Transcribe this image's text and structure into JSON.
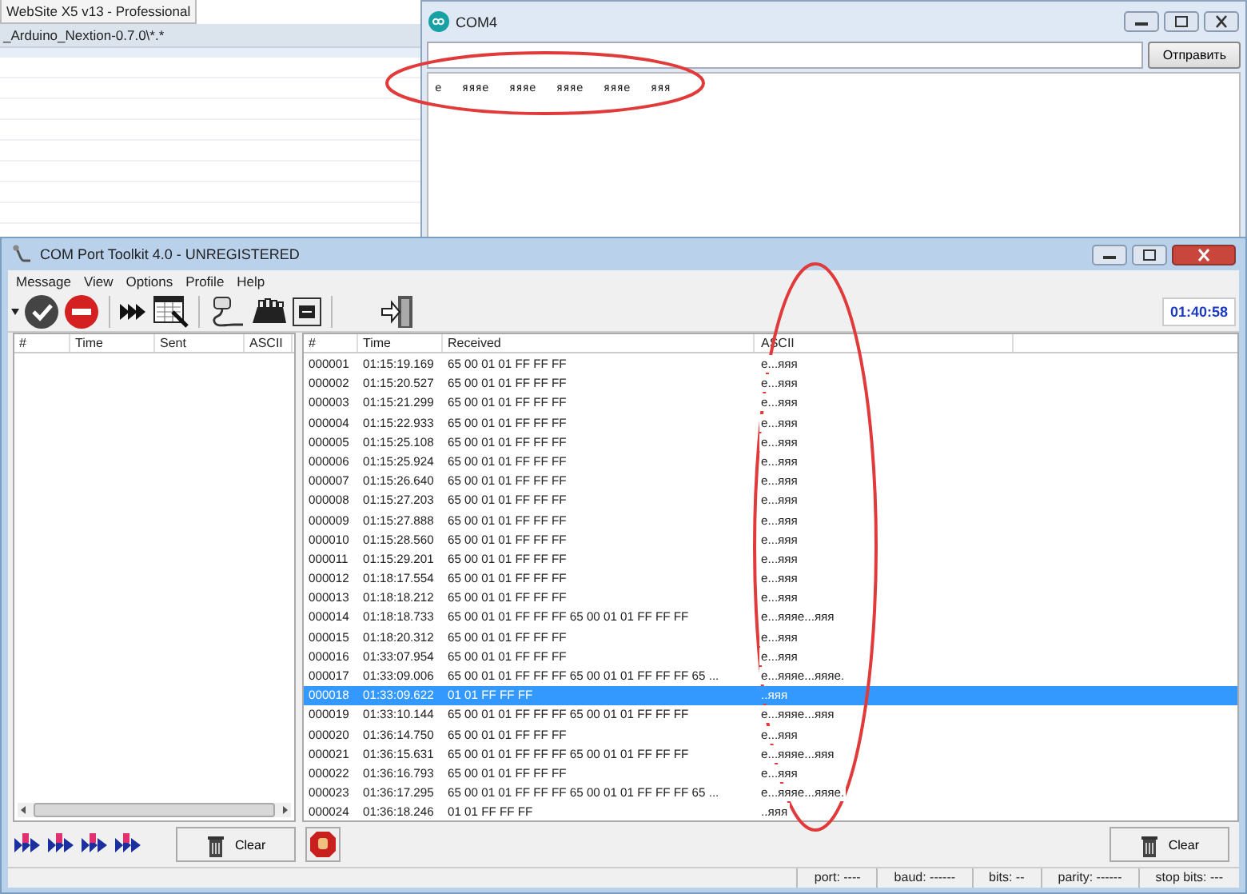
{
  "background_window": {
    "title": "WebSite X5 v13 - Professional",
    "path": "_Arduino_Nextion-0.7.0\\*.*"
  },
  "com4": {
    "title": "COM4",
    "send_button": "Отправить",
    "output": "e   яяяe   яяяe   яяяe   яяяe   яяя"
  },
  "toolkit": {
    "title": "COM Port Toolkit 4.0 - UNREGISTERED",
    "menu": [
      "Message",
      "View",
      "Options",
      "Profile",
      "Help"
    ],
    "clock": "01:40:58",
    "sent_table": {
      "columns": [
        "#",
        "Time",
        "Sent",
        "ASCII"
      ]
    },
    "received_table": {
      "columns": [
        "#",
        "Time",
        "Received",
        "ASCII"
      ],
      "rows": [
        {
          "num": "000001",
          "time": "01:15:19.169",
          "received": "65 00 01 01 FF FF FF",
          "ascii": "e...яяя",
          "selected": false
        },
        {
          "num": "000002",
          "time": "01:15:20.527",
          "received": "65 00 01 01 FF FF FF",
          "ascii": "e...яяя",
          "selected": false
        },
        {
          "num": "000003",
          "time": "01:15:21.299",
          "received": "65 00 01 01 FF FF FF",
          "ascii": "e...яяя",
          "selected": false
        },
        {
          "num": "000004",
          "time": "01:15:22.933",
          "received": "65 00 01 01 FF FF FF",
          "ascii": "e...яяя",
          "selected": false
        },
        {
          "num": "000005",
          "time": "01:15:25.108",
          "received": "65 00 01 01 FF FF FF",
          "ascii": "e...яяя",
          "selected": false
        },
        {
          "num": "000006",
          "time": "01:15:25.924",
          "received": "65 00 01 01 FF FF FF",
          "ascii": "e...яяя",
          "selected": false
        },
        {
          "num": "000007",
          "time": "01:15:26.640",
          "received": "65 00 01 01 FF FF FF",
          "ascii": "e...яяя",
          "selected": false
        },
        {
          "num": "000008",
          "time": "01:15:27.203",
          "received": "65 00 01 01 FF FF FF",
          "ascii": "e...яяя",
          "selected": false
        },
        {
          "num": "000009",
          "time": "01:15:27.888",
          "received": "65 00 01 01 FF FF FF",
          "ascii": "e...яяя",
          "selected": false
        },
        {
          "num": "000010",
          "time": "01:15:28.560",
          "received": "65 00 01 01 FF FF FF",
          "ascii": "e...яяя",
          "selected": false
        },
        {
          "num": "000011",
          "time": "01:15:29.201",
          "received": "65 00 01 01 FF FF FF",
          "ascii": "e...яяя",
          "selected": false
        },
        {
          "num": "000012",
          "time": "01:18:17.554",
          "received": "65 00 01 01 FF FF FF",
          "ascii": "e...яяя",
          "selected": false
        },
        {
          "num": "000013",
          "time": "01:18:18.212",
          "received": "65 00 01 01 FF FF FF",
          "ascii": "e...яяя",
          "selected": false
        },
        {
          "num": "000014",
          "time": "01:18:18.733",
          "received": "65 00 01 01 FF FF FF 65 00 01 01 FF FF FF",
          "ascii": "e...яяяe...яяя",
          "selected": false
        },
        {
          "num": "000015",
          "time": "01:18:20.312",
          "received": "65 00 01 01 FF FF FF",
          "ascii": "e...яяя",
          "selected": false
        },
        {
          "num": "000016",
          "time": "01:33:07.954",
          "received": "65 00 01 01 FF FF FF",
          "ascii": "e...яяя",
          "selected": false
        },
        {
          "num": "000017",
          "time": "01:33:09.006",
          "received": "65 00 01 01 FF FF FF 65 00 01 01 FF FF FF 65 ...",
          "ascii": "e...яяяe...яяяe.",
          "selected": false
        },
        {
          "num": "000018",
          "time": "01:33:09.622",
          "received": "01 01 FF FF FF",
          "ascii": "..яяя",
          "selected": true
        },
        {
          "num": "000019",
          "time": "01:33:10.144",
          "received": "65 00 01 01 FF FF FF 65 00 01 01 FF FF FF",
          "ascii": "e...яяяe...яяя",
          "selected": false
        },
        {
          "num": "000020",
          "time": "01:36:14.750",
          "received": "65 00 01 01 FF FF FF",
          "ascii": "e...яяя",
          "selected": false
        },
        {
          "num": "000021",
          "time": "01:36:15.631",
          "received": "65 00 01 01 FF FF FF 65 00 01 01 FF FF FF",
          "ascii": "e...яяяe...яяя",
          "selected": false
        },
        {
          "num": "000022",
          "time": "01:36:16.793",
          "received": "65 00 01 01 FF FF FF",
          "ascii": "e...яяя",
          "selected": false
        },
        {
          "num": "000023",
          "time": "01:36:17.295",
          "received": "65 00 01 01 FF FF FF 65 00 01 01 FF FF FF 65 ...",
          "ascii": "e...яяяe...яяяe.",
          "selected": false
        },
        {
          "num": "000024",
          "time": "01:36:18.246",
          "received": "01 01 FF FF FF",
          "ascii": "..яяя",
          "selected": false
        }
      ]
    },
    "clear_buttons": [
      "Clear",
      "Clear"
    ],
    "status_bar": [
      "port: ----",
      "baud: ------",
      "bits: --",
      "parity: ------",
      "stop bits: ---"
    ]
  }
}
